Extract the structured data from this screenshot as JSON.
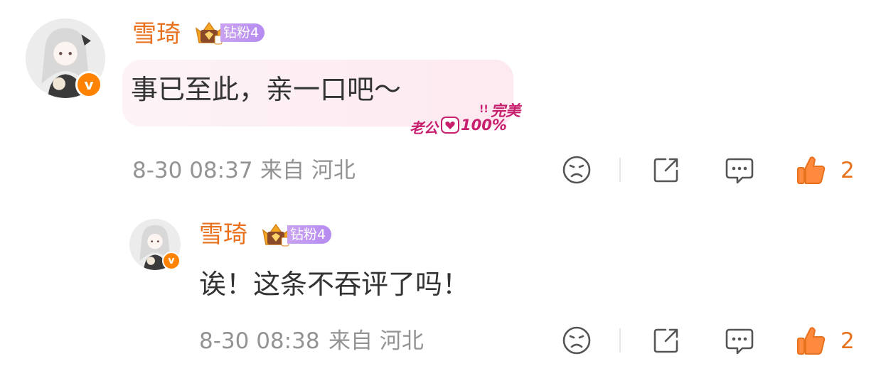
{
  "comments": [
    {
      "username": "雪琦",
      "fan_badge": "钻粉4",
      "text": "事已至此，亲一口吧～",
      "sticker": {
        "line1": "完美",
        "line2_left": "老公",
        "line2_right": "100%"
      },
      "time": "8-30 08:37",
      "location": "来自 河北",
      "likes": "2",
      "verified_badge": "v"
    },
    {
      "username": "雪琦",
      "fan_badge": "钻粉4",
      "text": "诶！这条不吞评了吗！",
      "time": "8-30 08:38",
      "location": "来自 河北",
      "likes": "2",
      "verified_badge": "v"
    }
  ],
  "colors": {
    "username": "#e8711e",
    "like_active": "#e8711e",
    "meta": "#939393",
    "fan_badge": "#b58bf0"
  },
  "icons": [
    "dislike-icon",
    "repost-icon",
    "comment-icon",
    "like-icon"
  ]
}
